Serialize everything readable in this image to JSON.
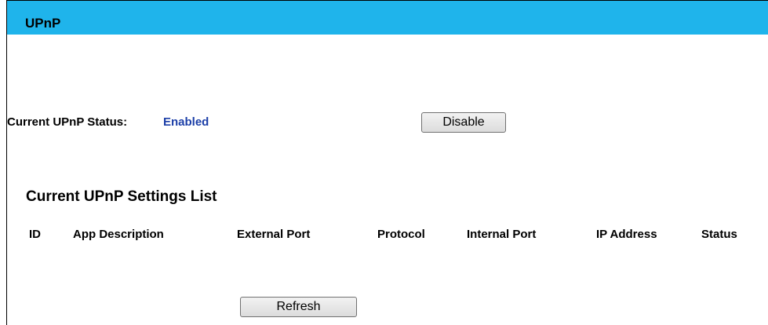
{
  "header": {
    "title": "UPnP",
    "color": "#1fb4eb"
  },
  "status": {
    "label": "Current UPnP Status:",
    "value": "Enabled",
    "value_color": "#1c3fa8",
    "toggle_button_label": "Disable"
  },
  "settings_list": {
    "title": "Current UPnP Settings List",
    "columns": [
      "ID",
      "App Description",
      "External Port",
      "Protocol",
      "Internal Port",
      "IP Address",
      "Status"
    ],
    "rows": [],
    "refresh_button_label": "Refresh"
  }
}
